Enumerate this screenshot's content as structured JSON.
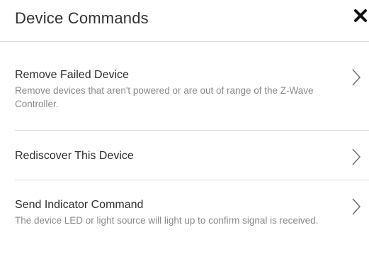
{
  "dialog": {
    "title": "Device Commands",
    "close_icon": "close-x-icon"
  },
  "commands": [
    {
      "title": "Remove Failed Device",
      "description": "Remove devices that aren't powered or are out of range of the Z-Wave Controller.",
      "icon": "chevron-right-icon"
    },
    {
      "title": "Rediscover This Device",
      "description": "",
      "icon": "chevron-right-icon"
    },
    {
      "title": "Send Indicator Command",
      "description": "The device LED or light source will light up to confirm signal is received.",
      "icon": "chevron-right-icon"
    }
  ]
}
